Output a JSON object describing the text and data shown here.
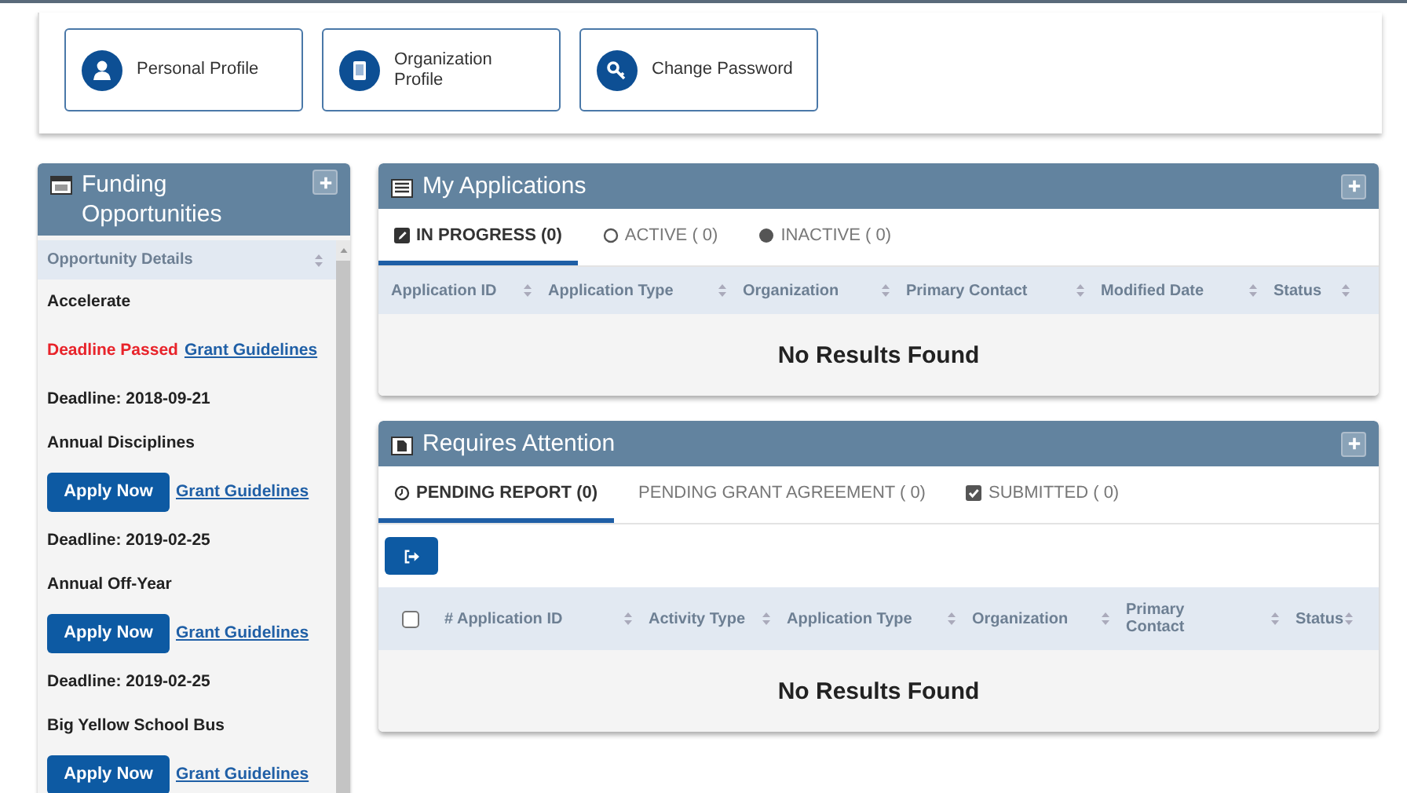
{
  "profile_buttons": [
    {
      "label": "Personal Profile"
    },
    {
      "label": "Organization Profile"
    },
    {
      "label": "Change Password"
    }
  ],
  "funding": {
    "title": "Funding Opportunities",
    "column": "Opportunity Details",
    "items": [
      {
        "name": "Accelerate",
        "kind": "passed",
        "status": "Deadline Passed",
        "link": "Grant Guidelines",
        "deadline": "Deadline: 2018-09-21"
      },
      {
        "name": "Annual Disciplines",
        "kind": "open",
        "status": "Apply Now",
        "link": "Grant Guidelines",
        "deadline": "Deadline: 2019-02-25"
      },
      {
        "name": "Annual Off-Year",
        "kind": "open",
        "status": "Apply Now",
        "link": "Grant Guidelines",
        "deadline": "Deadline: 2019-02-25"
      },
      {
        "name": "Big Yellow School Bus",
        "kind": "open",
        "status": "Apply Now",
        "link": "Grant Guidelines"
      }
    ]
  },
  "my_applications": {
    "title": "My Applications",
    "tabs": [
      {
        "label": "IN PROGRESS (0)",
        "selected": true
      },
      {
        "label": "ACTIVE ( 0)",
        "selected": false
      },
      {
        "label": "INACTIVE ( 0)",
        "selected": false
      }
    ],
    "columns": [
      "Application ID",
      "Application Type",
      "Organization",
      "Primary Contact",
      "Modified Date",
      "Status"
    ],
    "empty": "No Results Found"
  },
  "requires_attention": {
    "title": "Requires Attention",
    "tabs": [
      {
        "label": "PENDING REPORT (0)",
        "selected": true
      },
      {
        "label": "PENDING GRANT AGREEMENT ( 0)",
        "selected": false
      },
      {
        "label": "SUBMITTED ( 0)",
        "selected": false
      }
    ],
    "select_all_checked": false,
    "columns": [
      "# Application ID",
      "Activity Type",
      "Application Type",
      "Organization",
      "Primary Contact",
      "Status"
    ],
    "empty": "No Results Found"
  }
}
